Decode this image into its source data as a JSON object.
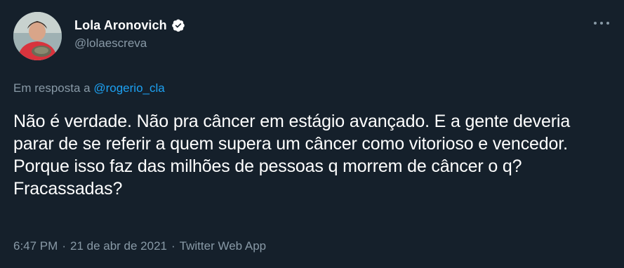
{
  "author": {
    "display_name": "Lola Aronovich",
    "handle": "@lolaescreva",
    "verified": true,
    "avatar_icon": "profile-photo"
  },
  "reply": {
    "prefix": "Em resposta a",
    "mention": "@rogerio_cla"
  },
  "tweet": {
    "text": "Não é verdade. Não pra câncer em estágio avançado. E a gente deveria parar de se referir a quem supera um câncer como vitorioso e vencedor. Porque isso faz das milhões de pessoas q morrem de câncer o q? Fracassadas?"
  },
  "meta": {
    "time": "6:47 PM",
    "separator": "·",
    "date": "21 de abr de 2021",
    "source": "Twitter Web App"
  },
  "colors": {
    "background": "#15202b",
    "accent": "#1da1f2",
    "secondary_text": "#8899a6"
  }
}
